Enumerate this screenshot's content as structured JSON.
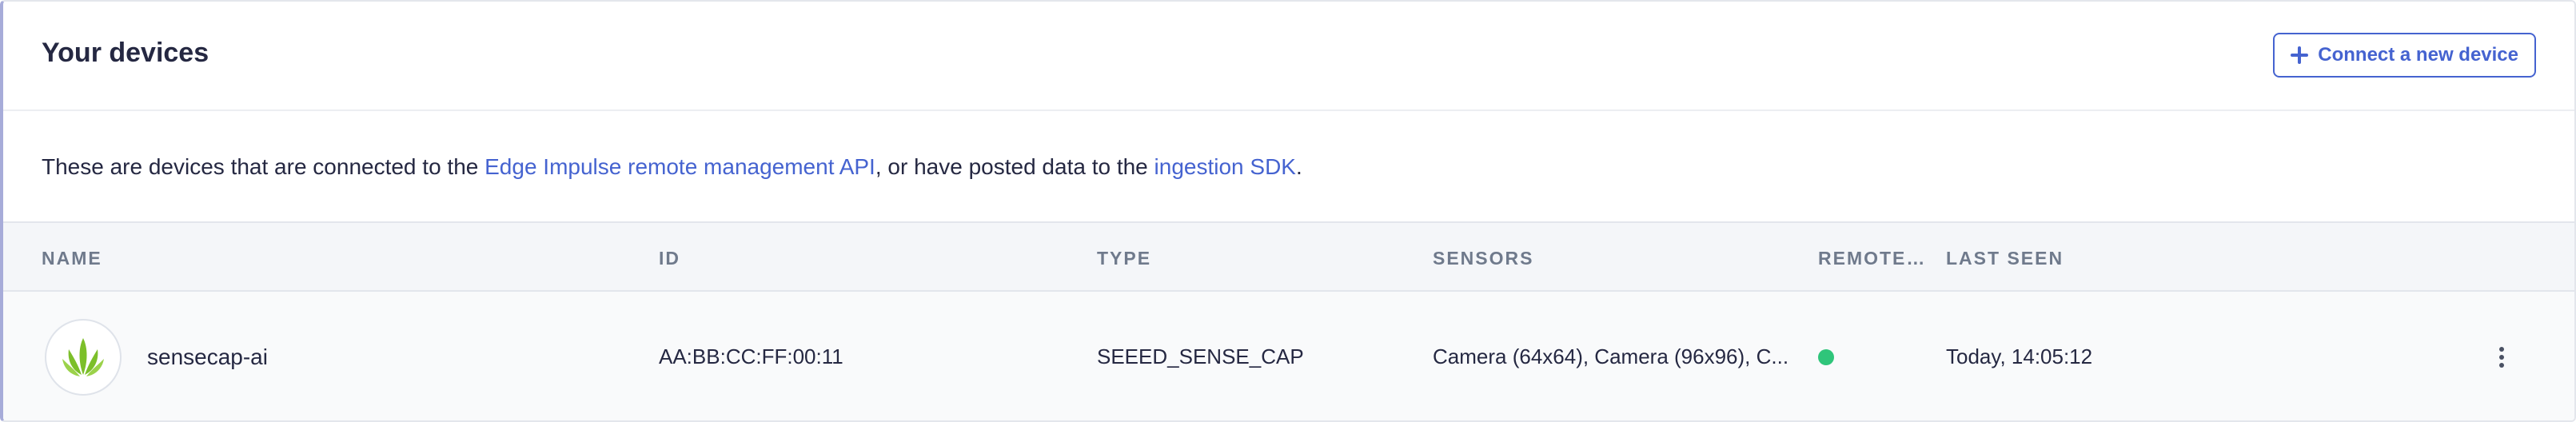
{
  "card": {
    "title": "Your devices",
    "connect_button_label": "Connect a new device",
    "description": {
      "text_before": "These are devices that are connected to the ",
      "link_remote": "Edge Impulse remote management API",
      "text_middle": ", or have posted data to the ",
      "link_sdk": "ingestion SDK",
      "text_after": "."
    }
  },
  "table": {
    "columns": [
      "NAME",
      "ID",
      "TYPE",
      "SENSORS",
      "REMOTE…",
      "LAST SEEN"
    ],
    "rows": [
      {
        "name": "sensecap-ai",
        "id": "AA:BB:CC:FF:00:11",
        "type": "SEEED_SENSE_CAP",
        "sensors": "Camera (64x64), Camera (96x96), C...",
        "remote_status": "connected",
        "last_seen": "Today, 14:05:12"
      }
    ]
  },
  "colors": {
    "accent": "#4563d0",
    "status_online": "#2fc57a",
    "logo_green": "#7cbf2a"
  },
  "icons": {
    "connect": "plus-icon",
    "device_logo": "leaf-logo-icon",
    "row_menu": "kebab-menu-icon"
  }
}
